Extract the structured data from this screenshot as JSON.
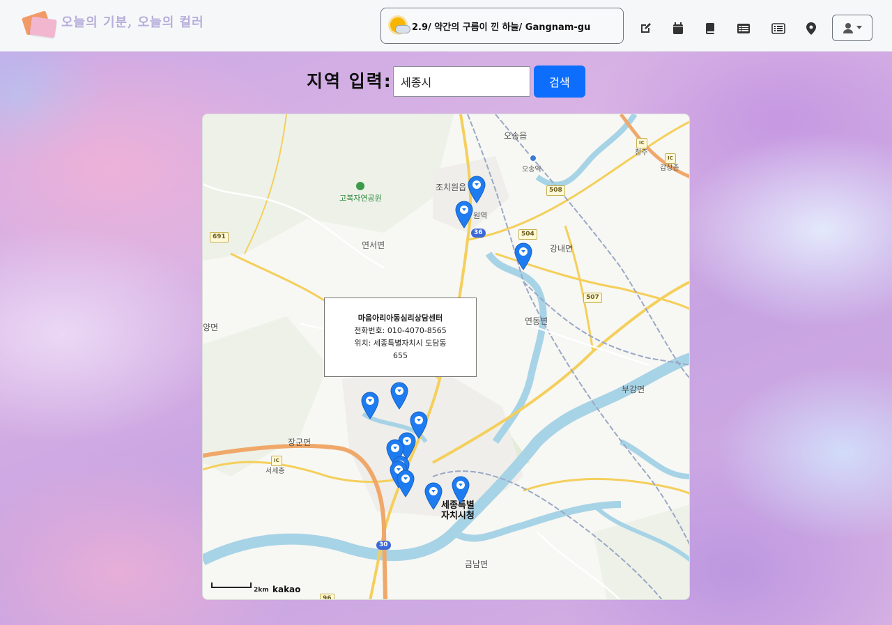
{
  "brand": {
    "title": "오늘의 기분, 오늘의 컬러",
    "icon": "notes-logo-icon"
  },
  "weather": {
    "icon": "partly-cloudy-icon",
    "text": "2.9/ 약간의 구름이 낀 하늘/ Gangnam-gu"
  },
  "nav": [
    {
      "name": "write-icon",
      "tip": "pen-to-square"
    },
    {
      "name": "calendar-icon",
      "tip": "calendar"
    },
    {
      "name": "diary-book-icon",
      "tip": "book"
    },
    {
      "name": "list-icon",
      "tip": "list"
    },
    {
      "name": "board-list-icon",
      "tip": "rectangle-list"
    },
    {
      "name": "location-pin-icon",
      "tip": "location-dot"
    }
  ],
  "user": {
    "icon": "user-icon",
    "caret": "caret-down-icon"
  },
  "search": {
    "label": "지역 입력:",
    "value": "세종시",
    "button": "검색"
  },
  "map": {
    "labels": {
      "osong_eup": "오송읍",
      "osong_station": "오송역",
      "cheongju": "청주",
      "gamsang": "감상촌",
      "jochiwon": "조치원읍",
      "jochiwon_station": "원역",
      "gobok_park": "고복자연공원",
      "yeonseo": "연서면",
      "gangnae": "강내면",
      "yeondong": "연동면",
      "yangmyeon": "양면",
      "bugang": "부강면",
      "janggun": "장군면",
      "seosejong": "서세종",
      "city_hall_1": "세종특별",
      "city_hall_2": "자치시청",
      "geumnam": "금남면"
    },
    "shields": {
      "r691": "691",
      "r508": "508",
      "r504": "504",
      "r507": "507",
      "r36": "36",
      "r30": "30",
      "r96": "96",
      "ic1": "IC",
      "ic2": "IC",
      "ic3": "IC"
    },
    "info": {
      "name": "마음아리아동심리상담센터",
      "phone": "전화번호: 010-4070-8565",
      "address1": "위치: 세종특별자치시 도담동",
      "address2": "655"
    },
    "scale": "2km",
    "provider": "kakao",
    "marker_color": "#1f7cf0"
  }
}
